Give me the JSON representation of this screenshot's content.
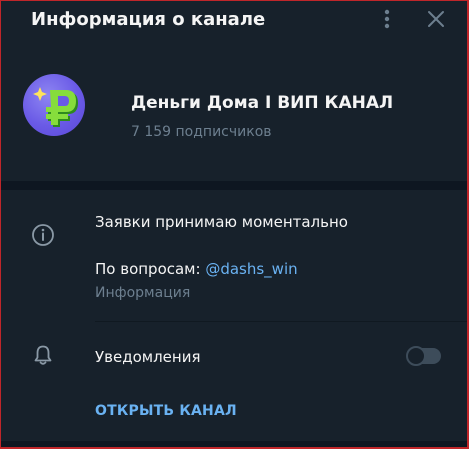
{
  "header": {
    "title": "Информация о канале",
    "more_icon": "more-vertical-icon",
    "close_icon": "close-icon"
  },
  "channel": {
    "name": "Деньги Дома I ВИП КАНАЛ",
    "subscribers": "7 159 подписчиков",
    "avatar_icon": "ruble-logo-icon"
  },
  "info": {
    "icon": "info-icon",
    "about": "Заявки принимаю моментально",
    "contact_prefix": "По вопросам: ",
    "contact_link": "@dashs_win",
    "caption": "Информация"
  },
  "notifications": {
    "icon": "bell-icon",
    "label": "Уведомления",
    "enabled": false
  },
  "actions": {
    "open_channel": "ОТКРЫТЬ КАНАЛ"
  },
  "colors": {
    "background": "#17212b",
    "band": "#0e1621",
    "text": "#f5f5f5",
    "muted": "#6d7f8f",
    "link": "#6ab2f2",
    "avatar": "#6a5ae6",
    "logo_green": "#7fd63a"
  }
}
